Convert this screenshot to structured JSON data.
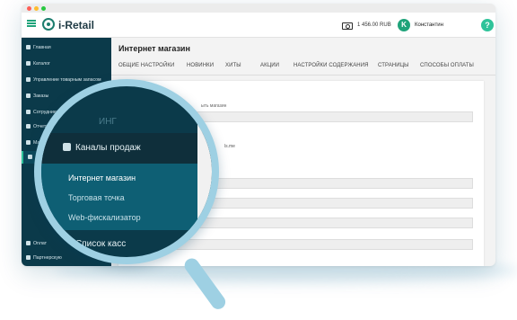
{
  "app": {
    "name": "i-Retail"
  },
  "header": {
    "balance": "1 456.00 RUB",
    "avatar_letter": "K",
    "user_name": "Константин",
    "help": "?"
  },
  "sidebar": {
    "items": [
      {
        "label": "Главная",
        "icon": "home-icon"
      },
      {
        "label": "Каталог",
        "icon": "catalog-icon"
      },
      {
        "label": "Управление товарным запасом",
        "icon": "inventory-icon"
      },
      {
        "label": "Заказы",
        "icon": "orders-icon"
      },
      {
        "label": "Сотрудники",
        "icon": "staff-icon"
      },
      {
        "label": "Отчеты",
        "icon": "reports-icon"
      },
      {
        "label": "Марк",
        "icon": "marker-icon"
      },
      {
        "label": "Оплат",
        "icon": "payment-icon"
      },
      {
        "label": "Партнерскую",
        "icon": "partner-icon"
      }
    ]
  },
  "main": {
    "title": "Интернет магазин",
    "tabs": [
      "ОБЩИЕ НАСТРОЙКИ",
      "НОВИНКИ",
      "ХИТЫ",
      "АКЦИИ",
      "НАСТРОЙКИ СОДЕРЖАНИЯ",
      "СТРАНИЦЫ",
      "СПОСОБЫ ОПЛАТЫ"
    ],
    "card": {
      "id": "ID 2352",
      "label_fragment": "ыть магазин",
      "url_fragment": "ls.me"
    }
  },
  "magnifier": {
    "top_label": "ИНГ",
    "group": "Каналы продаж",
    "subitems": [
      "Интернет магазин",
      "Торговая точка",
      "Web-фискализатор"
    ],
    "below": "Список касс"
  },
  "colors": {
    "sidebar": "#0b3a4a",
    "accent": "#1fa37a",
    "active_sub": "#0e5f74",
    "lens_ring": "#9ed0e3"
  }
}
